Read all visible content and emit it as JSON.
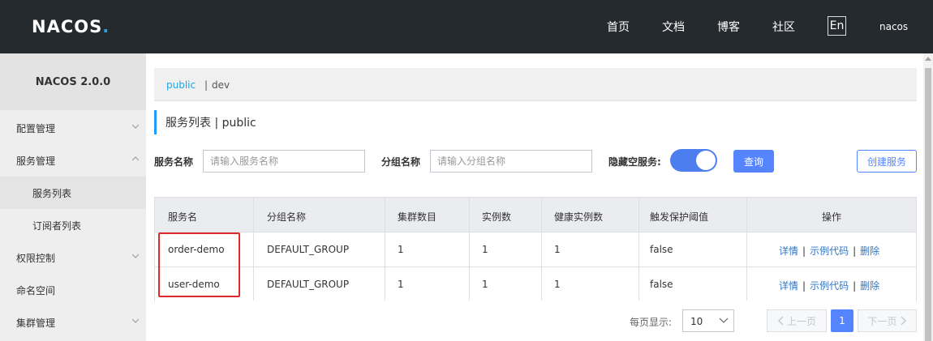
{
  "header": {
    "logo_text": "NACOS",
    "logo_dot": ".",
    "nav": [
      "首页",
      "文档",
      "博客",
      "社区"
    ],
    "lang": "En",
    "user": "nacos"
  },
  "sidebar": {
    "version": "NACOS 2.0.0",
    "items": [
      {
        "label": "配置管理",
        "chevron": "down"
      },
      {
        "label": "服务管理",
        "chevron": "up"
      },
      {
        "label": "服务列表",
        "chevron": ""
      },
      {
        "label": "订阅者列表",
        "chevron": ""
      },
      {
        "label": "权限控制",
        "chevron": "down"
      },
      {
        "label": "命名空间",
        "chevron": ""
      },
      {
        "label": "集群管理",
        "chevron": "down"
      }
    ]
  },
  "namespace": {
    "active": "public",
    "separator": "|",
    "other": "dev"
  },
  "page": {
    "title": "服务列表 | public"
  },
  "filters": {
    "service_name_label": "服务名称",
    "service_name_placeholder": "请输入服务名称",
    "group_name_label": "分组名称",
    "group_name_placeholder": "请输入分组名称",
    "hide_empty_label": "隐藏空服务:",
    "hide_empty_on": true,
    "query_button": "查询",
    "create_button": "创建服务"
  },
  "table": {
    "columns": [
      "服务名",
      "分组名称",
      "集群数目",
      "实例数",
      "健康实例数",
      "触发保护阈值",
      "操作"
    ],
    "rows": [
      {
        "service": "order-demo",
        "group": "DEFAULT_GROUP",
        "clusters": "1",
        "instances": "1",
        "healthy": "1",
        "threshold": "false"
      },
      {
        "service": "user-demo",
        "group": "DEFAULT_GROUP",
        "clusters": "1",
        "instances": "1",
        "healthy": "1",
        "threshold": "false"
      }
    ],
    "ops": {
      "detail": "详情",
      "sample": "示例代码",
      "delete": "删除",
      "sep": "|"
    }
  },
  "pagination": {
    "page_size_label": "每页显示:",
    "page_size": "10",
    "prev": "上一页",
    "current": "1",
    "next": "下一页"
  },
  "colors": {
    "header_bg": "#252a2f",
    "primary": "#5584ff",
    "link": "#2f76c4",
    "highlight": "#e02a2a"
  }
}
